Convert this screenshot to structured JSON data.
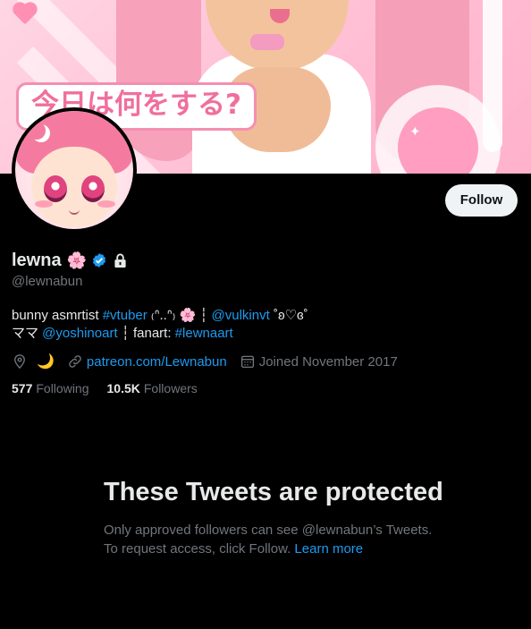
{
  "banner": {
    "caption": "今日は何をする?"
  },
  "header": {
    "follow_label": "Follow"
  },
  "profile": {
    "display_name": "lewna",
    "name_emoji": "🌸",
    "handle": "@lewnabun",
    "bio": {
      "line1_a": "bunny asmrtist ",
      "line1_tag": "#vtuber",
      "line1_b": " ₍ᐢ..ᐢ₎ 🌸 ┆ ",
      "line1_mention": "@vulkinvt",
      "line1_c": " ˚ʚ♡ɞ˚",
      "line2_a": "ママ ",
      "line2_mention": "@yoshinoart",
      "line2_b": " ┆ fanart: ",
      "line2_tag": "#lewnaart"
    },
    "location_emoji": "🌙",
    "website": "patreon.com/Lewnabun",
    "joined": "Joined November 2017",
    "following_count": "577",
    "following_label": "Following",
    "followers_count": "10.5K",
    "followers_label": "Followers"
  },
  "protected": {
    "title": "These Tweets are protected",
    "body": "Only approved followers can see @lewnabun’s Tweets. To request access, click Follow. ",
    "learn_more": "Learn more"
  },
  "colors": {
    "accent": "#1d9bf0",
    "muted": "#71767b",
    "text": "#e7e9ea",
    "background": "#000000"
  }
}
